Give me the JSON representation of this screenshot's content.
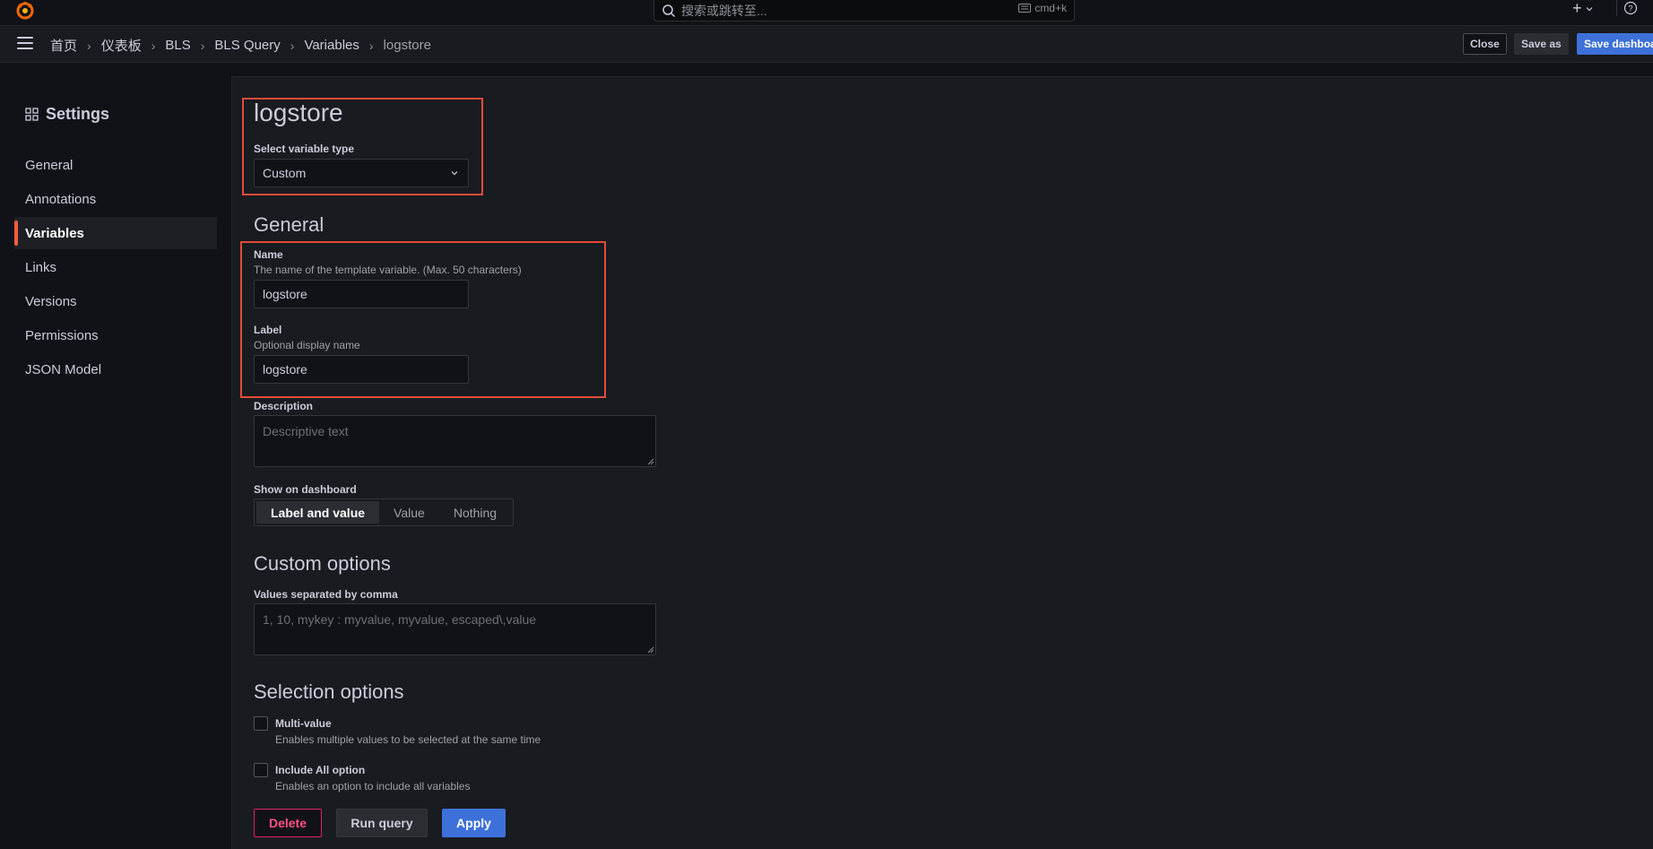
{
  "topbar": {
    "search_placeholder": "搜索或跳转至...",
    "shortcut": "cmd+k"
  },
  "breadcrumb": {
    "items": [
      "首页",
      "仪表板",
      "BLS",
      "BLS Query",
      "Variables"
    ],
    "current": "logstore"
  },
  "toolbar": {
    "close_label": "Close",
    "save_as_label": "Save as",
    "save_dashboard_label": "Save dashboard"
  },
  "sidebar": {
    "title": "Settings",
    "items": [
      {
        "label": "General"
      },
      {
        "label": "Annotations"
      },
      {
        "label": "Variables",
        "active": true
      },
      {
        "label": "Links"
      },
      {
        "label": "Versions"
      },
      {
        "label": "Permissions"
      },
      {
        "label": "JSON Model"
      }
    ]
  },
  "editor": {
    "title": "logstore",
    "type_label": "Select variable type",
    "type_value": "Custom",
    "general_heading": "General",
    "name_label": "Name",
    "name_desc": "The name of the template variable. (Max. 50 characters)",
    "name_value": "logstore",
    "label_label": "Label",
    "label_desc": "Optional display name",
    "label_value": "logstore",
    "description_label": "Description",
    "description_placeholder": "Descriptive text",
    "show_label": "Show on dashboard",
    "show_options": [
      "Label and value",
      "Value",
      "Nothing"
    ],
    "show_selected": "Label and value",
    "custom_heading": "Custom options",
    "values_label": "Values separated by comma",
    "values_placeholder": "1, 10, mykey : myvalue, myvalue, escaped\\,value",
    "selection_heading": "Selection options",
    "multi_label": "Multi-value",
    "multi_desc": "Enables multiple values to be selected at the same time",
    "multi_checked": false,
    "includeall_label": "Include All option",
    "includeall_desc": "Enables an option to include all variables",
    "includeall_checked": false
  },
  "actions": {
    "delete_label": "Delete",
    "run_label": "Run query",
    "apply_label": "Apply"
  },
  "colors": {
    "accent": "#f55f3e",
    "primary": "#3d71d9",
    "danger": "#e0226e",
    "highlight": "#e24b3b"
  }
}
